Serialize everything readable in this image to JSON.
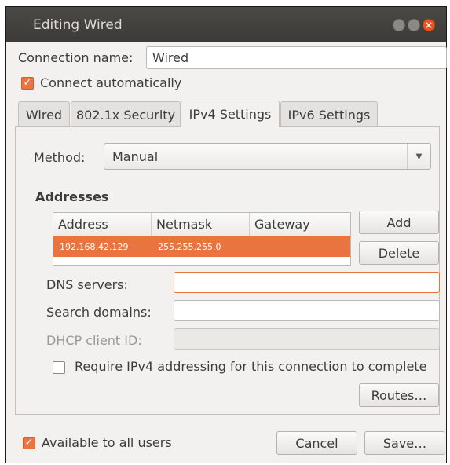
{
  "window": {
    "title": "Editing Wired"
  },
  "connection_name": {
    "label": "Connection name:",
    "value": "Wired"
  },
  "connect_automatically": {
    "label": "Connect automatically",
    "checked": true
  },
  "tabs": [
    {
      "label": "Wired",
      "active": false
    },
    {
      "label": "802.1x Security",
      "active": false
    },
    {
      "label": "IPv4 Settings",
      "active": true
    },
    {
      "label": "IPv6 Settings",
      "active": false
    }
  ],
  "ipv4": {
    "method_label": "Method:",
    "method_value": "Manual",
    "addresses_heading": "Addresses",
    "columns": [
      "Address",
      "Netmask",
      "Gateway"
    ],
    "rows": [
      {
        "address": "192.168.42.129",
        "netmask": "255.255.255.0",
        "gateway": ""
      }
    ],
    "add_label": "Add",
    "delete_label": "Delete",
    "dns_label": "DNS servers:",
    "dns_value": "",
    "search_label": "Search domains:",
    "search_value": "",
    "dhcp_label": "DHCP client ID:",
    "dhcp_value": "",
    "require_label": "Require IPv4 addressing for this connection to complete",
    "require_checked": false,
    "routes_label": "Routes…"
  },
  "footer": {
    "available_label": "Available to all users",
    "available_checked": true,
    "cancel_label": "Cancel",
    "save_label": "Save…"
  },
  "colors": {
    "accent": "#e9743f",
    "titlebar": "#3c3b37",
    "window_bg": "#f2f1f0"
  }
}
